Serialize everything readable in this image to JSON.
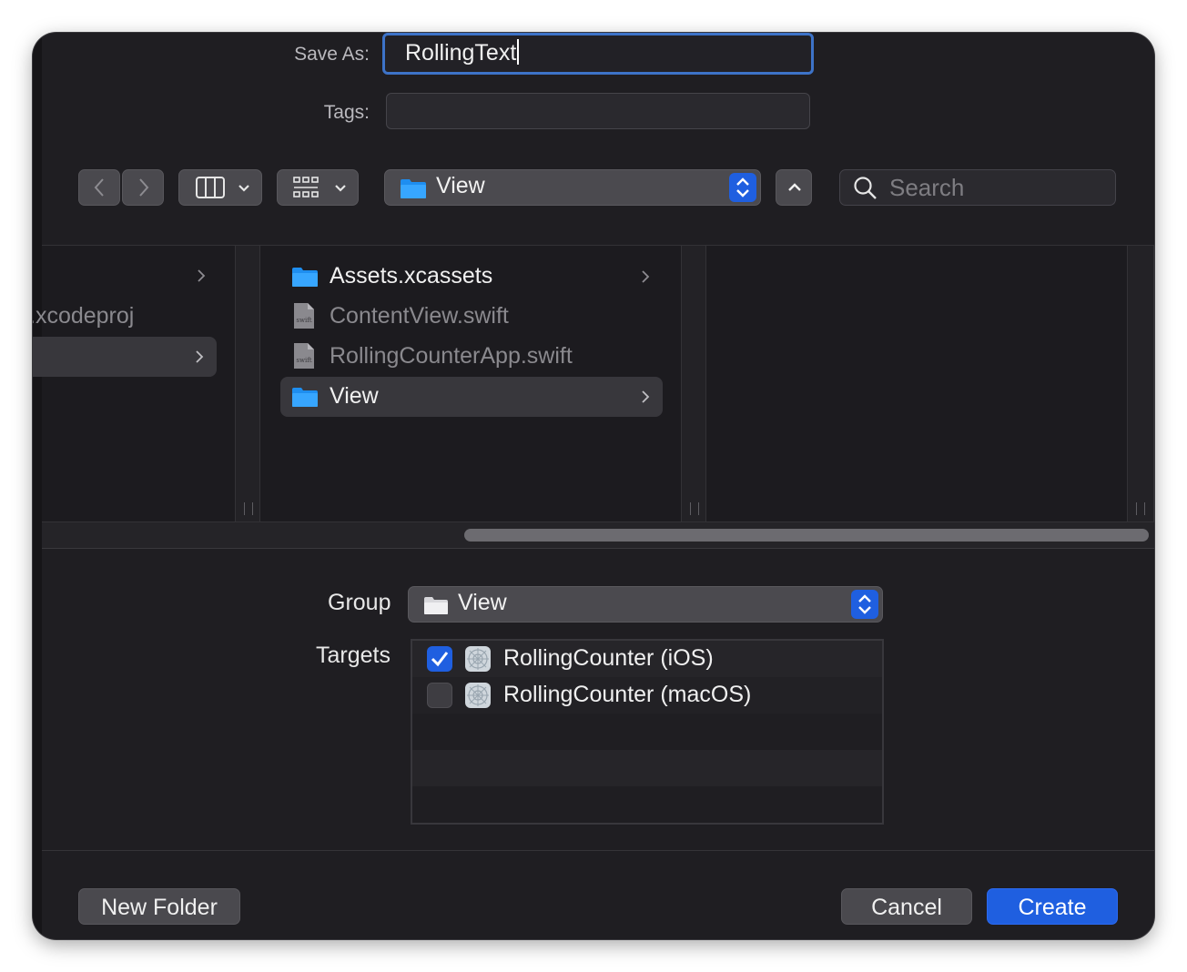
{
  "save_as": {
    "label": "Save As:",
    "value": "RollingText"
  },
  "tags": {
    "label": "Tags:",
    "value": ""
  },
  "toolbar": {
    "back_icon": "chevron-left-icon",
    "forward_icon": "chevron-right-icon",
    "column_view_icon": "column-view-icon",
    "group_icon": "grid-group-icon",
    "location": "View",
    "enclosing_icon": "chevron-up-icon",
    "search_placeholder": "Search"
  },
  "browser": {
    "column1": {
      "items": [
        {
          "label": ".xcodeproj"
        }
      ]
    },
    "column2": {
      "items": [
        {
          "label": "Assets.xcassets",
          "kind": "folder"
        },
        {
          "label": "ContentView.swift",
          "kind": "swift"
        },
        {
          "label": "RollingCounterApp.swift",
          "kind": "swift"
        },
        {
          "label": "View",
          "kind": "folder",
          "selected": true
        }
      ]
    },
    "swift_badge": "swift"
  },
  "options": {
    "group_label": "Group",
    "group_value": "View",
    "targets_label": "Targets",
    "targets": [
      {
        "label": "RollingCounter (iOS)",
        "checked": true
      },
      {
        "label": "RollingCounter (macOS)",
        "checked": false
      }
    ]
  },
  "buttons": {
    "new_folder": "New Folder",
    "cancel": "Cancel",
    "create": "Create"
  },
  "colors": {
    "accent": "#1f5fe0",
    "background": "#1f1e22",
    "focus_ring": "#3d73c8"
  }
}
